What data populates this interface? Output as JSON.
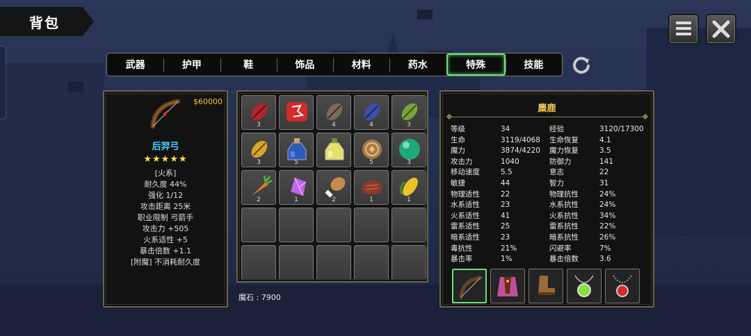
{
  "title": "背包",
  "tabs": [
    {
      "label": "武器",
      "active": false
    },
    {
      "label": "护甲",
      "active": false
    },
    {
      "label": "鞋",
      "active": false
    },
    {
      "label": "饰品",
      "active": false
    },
    {
      "label": "材料",
      "active": false
    },
    {
      "label": "药水",
      "active": false
    },
    {
      "label": "特殊",
      "active": true
    },
    {
      "label": "技能",
      "active": false
    }
  ],
  "item": {
    "price": "$60000",
    "icon": "bow-icon",
    "name": "后羿弓",
    "stars": "★★★★★",
    "props": [
      "[火系]",
      "耐久度 44%",
      "强化 1/12",
      "攻击距离  25米",
      "职业限制  弓箭手",
      "攻击力  +505",
      "火系适性  +5",
      "暴击倍数  +1.1",
      "[附魔] 不消耗耐久度"
    ]
  },
  "inventory": [
    {
      "icon": "red-bean-icon",
      "count": "3"
    },
    {
      "icon": "red-rune-stone-icon",
      "count": ""
    },
    {
      "icon": "brown-bean-icon",
      "count": "4"
    },
    {
      "icon": "blue-bean-icon",
      "count": "4"
    },
    {
      "icon": "green-bean-icon",
      "count": "3"
    },
    {
      "icon": "yellow-bean-icon",
      "count": "3"
    },
    {
      "icon": "blue-potion-icon",
      "count": "5"
    },
    {
      "icon": "yellow-potion-icon",
      "count": ""
    },
    {
      "icon": "coin-icon",
      "count": "5"
    },
    {
      "icon": "green-orb-icon",
      "count": "3"
    },
    {
      "icon": "carrot-icon",
      "count": "2"
    },
    {
      "icon": "purple-crystal-icon",
      "count": "1"
    },
    {
      "icon": "drumstick-icon",
      "count": "2"
    },
    {
      "icon": "steak-icon",
      "count": "1"
    },
    {
      "icon": "corn-icon",
      "count": "1"
    }
  ],
  "empty_slots": 10,
  "gems_label": "魔石 : 7900",
  "character": {
    "name": "麋鹿",
    "stats": [
      [
        "等级",
        "34",
        "经验",
        "3120/17300"
      ],
      [
        "生命",
        "3119/4068",
        "生命恢复",
        "4.1"
      ],
      [
        "魔力",
        "3874/4220",
        "魔力恢复",
        "3.5"
      ],
      [
        "攻击力",
        "1040",
        "防御力",
        "141"
      ],
      [
        "移动速度",
        "5.5",
        "意志",
        "22"
      ],
      [
        "敏捷",
        "44",
        "智力",
        "31"
      ],
      [
        "物理适性",
        "22",
        "物理抗性",
        "24%"
      ],
      [
        "水系适性",
        "23",
        "水系抗性",
        "24%"
      ],
      [
        "火系适性",
        "41",
        "火系抗性",
        "34%"
      ],
      [
        "雷系适性",
        "25",
        "雷系抗性",
        "22%"
      ],
      [
        "暗系适性",
        "23",
        "暗系抗性",
        "26%"
      ],
      [
        "毒抗性",
        "21%",
        "闪避率",
        "7%"
      ],
      [
        "暴击率",
        "1%",
        "暴击倍数",
        "3.6"
      ]
    ],
    "equipment": [
      {
        "icon": "bow-icon",
        "active": true
      },
      {
        "icon": "cloak-armor-icon",
        "active": false
      },
      {
        "icon": "boots-icon",
        "active": false
      },
      {
        "icon": "green-amulet-icon",
        "active": false
      },
      {
        "icon": "red-amulet-icon",
        "active": false
      }
    ]
  },
  "colors": {
    "active_tab": "#6fe07a",
    "item_name": "#3fd0ff",
    "price": "#f0c830",
    "char_name": "#f3c858"
  }
}
